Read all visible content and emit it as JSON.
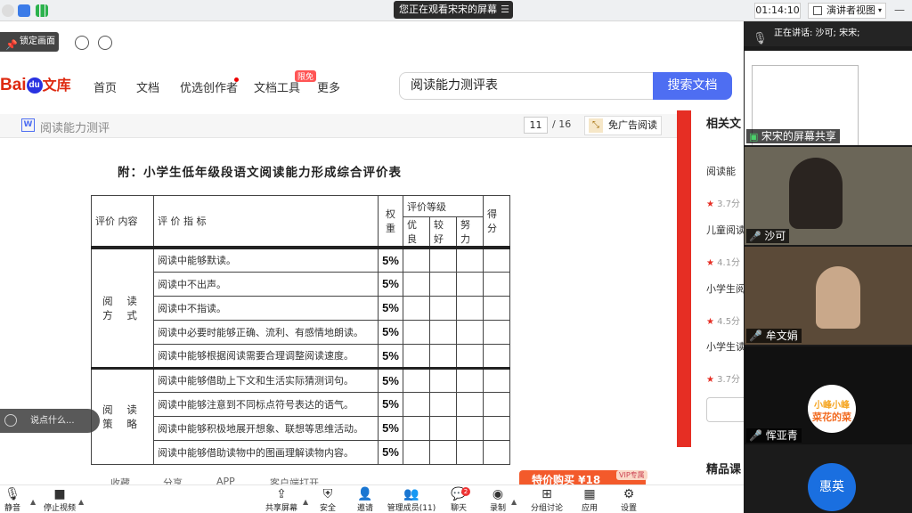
{
  "topbar": {
    "viewing_label": "您正在观看宋宋的屏幕",
    "timer": "01:14:10",
    "view_button": "演讲者视图"
  },
  "browser": {
    "lock_label": "锁定画面"
  },
  "site": {
    "logo_text": "Bai",
    "logo_paw": "du",
    "logo_suffix": "文库",
    "nav": [
      "首页",
      "文档",
      "优选创作者",
      "文档工具",
      "更多"
    ],
    "badge_new": "限免",
    "search_value": "阅读能力测评表",
    "search_button": "搜索文档"
  },
  "doc": {
    "title": "阅读能力测评",
    "page_current": "11",
    "page_total": "/ 16",
    "noad_button": "免广告阅读",
    "heading": "附：小学生低年级段语文阅读能力形成综合评价表",
    "table": {
      "header": {
        "content": "评价 内容",
        "indicator": "评 价 指 标",
        "weight": "权重",
        "level": "评价等级",
        "score": "得分",
        "levels": [
          "优良",
          "较好",
          "努力"
        ]
      },
      "categories": [
        "阅 读 方 式",
        "阅 读 策 略"
      ],
      "rows": [
        {
          "text": "阅读中能够默读。",
          "weight": "5%"
        },
        {
          "text": "阅读中不出声。",
          "weight": "5%"
        },
        {
          "text": "阅读中不指读。",
          "weight": "5%"
        },
        {
          "text": "阅读中必要时能够正确、流利、有感情地朗读。",
          "weight": "5%"
        },
        {
          "text": "阅读中能够根据阅读需要合理调整阅读速度。",
          "weight": "5%"
        },
        {
          "text": "阅读中能够借助上下文和生活实际猜测词句。",
          "weight": "5%"
        },
        {
          "text": "阅读中能够注意到不同标点符号表达的语气。",
          "weight": "5%"
        },
        {
          "text": "阅读中能够积极地展开想象、联想等思维活动。",
          "weight": "5%"
        },
        {
          "text": "阅读中能够借助读物中的图画理解读物内容。",
          "weight": "5%"
        }
      ]
    }
  },
  "sidebar": {
    "title": "相关文",
    "items": [
      {
        "title": "阅读能",
        "score": "3.7分"
      },
      {
        "title": "儿童阅读",
        "score": "4.1分"
      },
      {
        "title": "小学生阅",
        "score": "4.5分"
      },
      {
        "title": "小学生读",
        "score": "3.7分"
      }
    ],
    "bottom_title": "精品课"
  },
  "chat": {
    "placeholder": "说点什么..."
  },
  "bottom_strip": {
    "items": [
      "收藏",
      "分享",
      "APP",
      "客户端打开"
    ],
    "promo": "特价购买 ¥18",
    "vip": "VIP专属"
  },
  "panel": {
    "speaking": "正在讲话: 沙可; 宋宋;",
    "tiles": [
      {
        "label": "宋宋的屏幕共享"
      },
      {
        "label": "沙可"
      },
      {
        "label": "牟文娟"
      },
      {
        "label": "恽亚青",
        "avatar_line1": "小峰小峰",
        "avatar_line2": "菜花的菜"
      }
    ],
    "self_name": "惠英"
  },
  "toolbar": {
    "items": [
      "静音",
      "停止视频",
      "共享屏幕",
      "安全",
      "邀请",
      "管理成员(11)",
      "聊天",
      "录制",
      "分组讨论",
      "应用",
      "设置"
    ],
    "chat_badge": "2"
  },
  "colors": {
    "accent_blue": "#4e6ef2",
    "baidu_red": "#de2910",
    "zoom_blue": "#1a6fe0"
  }
}
